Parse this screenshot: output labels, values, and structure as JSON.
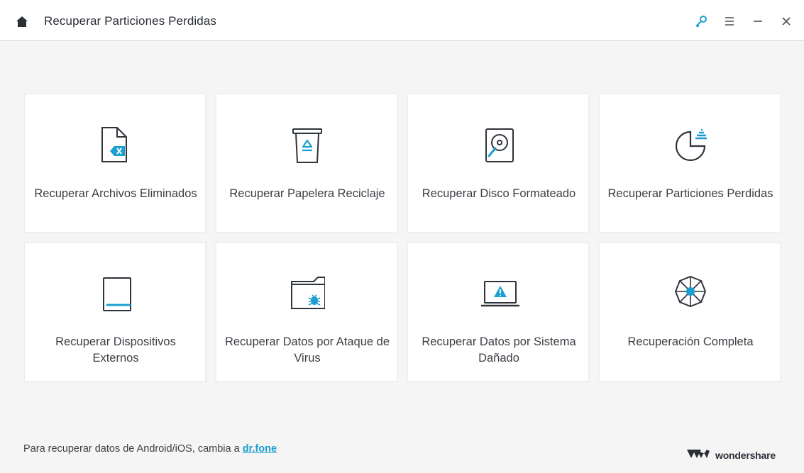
{
  "window": {
    "title": "Recuperar Particiones Perdidas"
  },
  "cards": [
    {
      "label": "Recuperar Archivos Eliminados",
      "icon": "deleted-file-icon"
    },
    {
      "label": "Recuperar Papelera Reciclaje",
      "icon": "recycle-bin-icon"
    },
    {
      "label": "Recuperar Disco Formateado",
      "icon": "formatted-disk-icon"
    },
    {
      "label": "Recuperar Particiones Perdidas",
      "icon": "lost-partition-icon"
    },
    {
      "label_line1": "Recuperar Dispositivos",
      "label_line2": "Externos",
      "icon": "external-device-icon"
    },
    {
      "label_line1": "Recuperar Datos por Ataque de",
      "label_line2": "Virus",
      "icon": "virus-folder-icon"
    },
    {
      "label_line1": "Recuperar Datos por Sistema",
      "label_line2": "Dañado",
      "icon": "crashed-system-icon"
    },
    {
      "label": "Recuperación Completa",
      "icon": "complete-recovery-icon"
    }
  ],
  "footer": {
    "text": "Para recuperar datos de Android/iOS, cambia a ",
    "link": "dr.fone",
    "brand": "wondershare"
  },
  "colors": {
    "accent": "#1a9fd0",
    "icon_dark": "#2f343b",
    "background": "#f5f5f6"
  }
}
